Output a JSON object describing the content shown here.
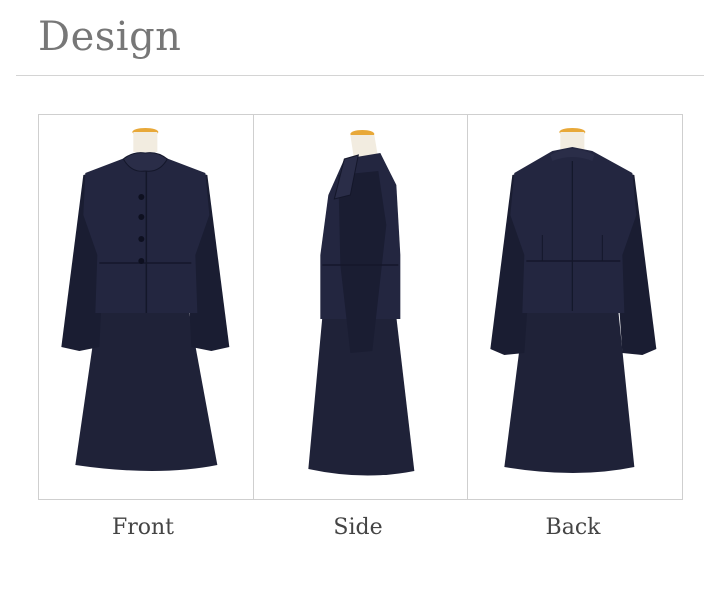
{
  "header": {
    "title": "Design"
  },
  "views": [
    {
      "id": "front",
      "label": "Front"
    },
    {
      "id": "side",
      "label": "Side"
    },
    {
      "id": "back",
      "label": "Back"
    }
  ],
  "colors": {
    "garment": "#1f2238",
    "garment_shadow": "#14172a",
    "mannequin": "#e8a838",
    "mannequin_base": "#f2ece0",
    "border": "#cfcfcf",
    "title": "#777777"
  }
}
